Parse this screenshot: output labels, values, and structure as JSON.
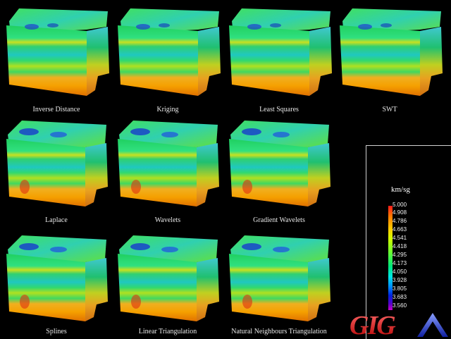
{
  "panels": [
    {
      "label": "Inverse Distance"
    },
    {
      "label": "Kriging"
    },
    {
      "label": "Least Squares"
    },
    {
      "label": "SWT"
    },
    {
      "label": "Laplace"
    },
    {
      "label": "Wavelets"
    },
    {
      "label": "Gradient Wavelets"
    },
    {
      "label": "Splines"
    },
    {
      "label": "Linear Triangulation"
    },
    {
      "label": "Natural Neighbours Triangulation"
    }
  ],
  "legend": {
    "unit": "km/sg",
    "ticks": [
      "5.000",
      "4.908",
      "4.786",
      "4.663",
      "4.541",
      "4.418",
      "4.295",
      "4.173",
      "4.050",
      "3.928",
      "3.805",
      "3.683",
      "3.560"
    ]
  },
  "logo": {
    "text": "GIGA"
  }
}
